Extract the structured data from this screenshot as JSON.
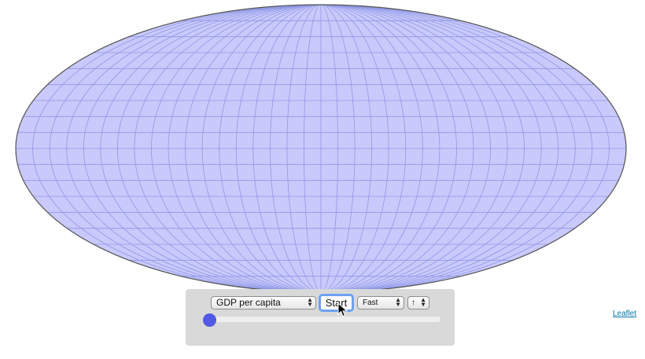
{
  "map": {
    "projection": "ellipse-graticule",
    "fill_color": "#c9c9fb",
    "graticule_color": "#8f98e6",
    "outline_color": "#555555"
  },
  "controls": {
    "indicator_select_value": "GDP per capita",
    "start_label": "Start",
    "speed_select_value": "Fast",
    "direction_symbol": "↑",
    "slider_value": 0,
    "slider_color": "#5258e4"
  },
  "attribution": {
    "text": "Leaflet",
    "color": "#0078a8"
  },
  "icons": {
    "cursor": "arrow-pointer-icon",
    "select_arrows": "up-down-chevron-icon"
  }
}
